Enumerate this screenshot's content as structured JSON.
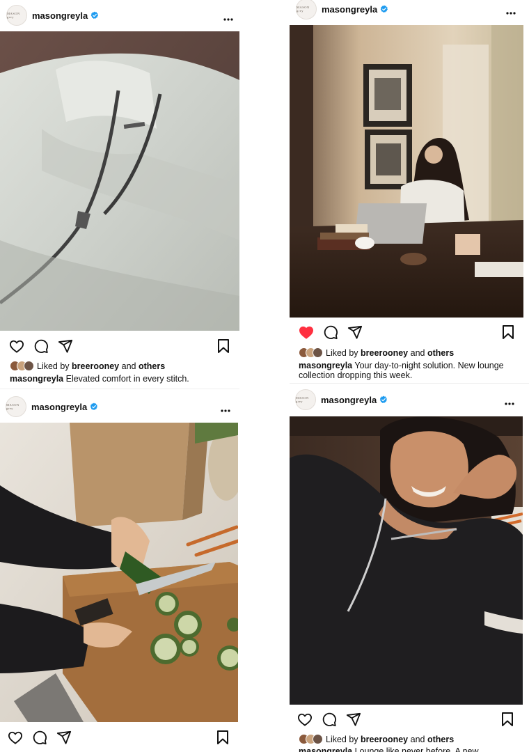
{
  "posts": [
    {
      "username": "masongreyla",
      "avatar_text": "MASON grey",
      "liked_by_prefix": "Liked by",
      "liked_by_user": "breerooney",
      "liked_by_and": "and",
      "liked_by_others": "others",
      "caption_user": "masongreyla",
      "caption_text": "Elevated comfort in every stitch.",
      "liked": false
    },
    {
      "username": "masongreyla",
      "avatar_text": "MASON grey",
      "liked_by_prefix": "Liked by",
      "liked_by_user": "breerooney",
      "liked_by_and": "and",
      "liked_by_others": "others",
      "caption_user": "masongreyla",
      "caption_text": "Your day-to-night solution. New lounge collection dropping this week.",
      "liked": true
    },
    {
      "username": "masongreyla",
      "avatar_text": "MASON grey",
      "liked": false
    },
    {
      "username": "masongreyla",
      "avatar_text": "MASON grey",
      "liked_by_prefix": "Liked by",
      "liked_by_user": "breerooney",
      "liked_by_and": "and",
      "liked_by_others": "others",
      "caption_user": "masongreyla",
      "caption_text": "Lounge like never before. A new",
      "liked": false
    }
  ],
  "colors": {
    "verified_blue": "#1d9bf0",
    "like_red": "#ff3040",
    "text": "#111111"
  },
  "icons": {
    "verified": "verified-badge-icon",
    "more": "more-options-icon",
    "like": "heart-icon",
    "comment": "comment-icon",
    "share": "share-icon",
    "save": "bookmark-icon"
  }
}
